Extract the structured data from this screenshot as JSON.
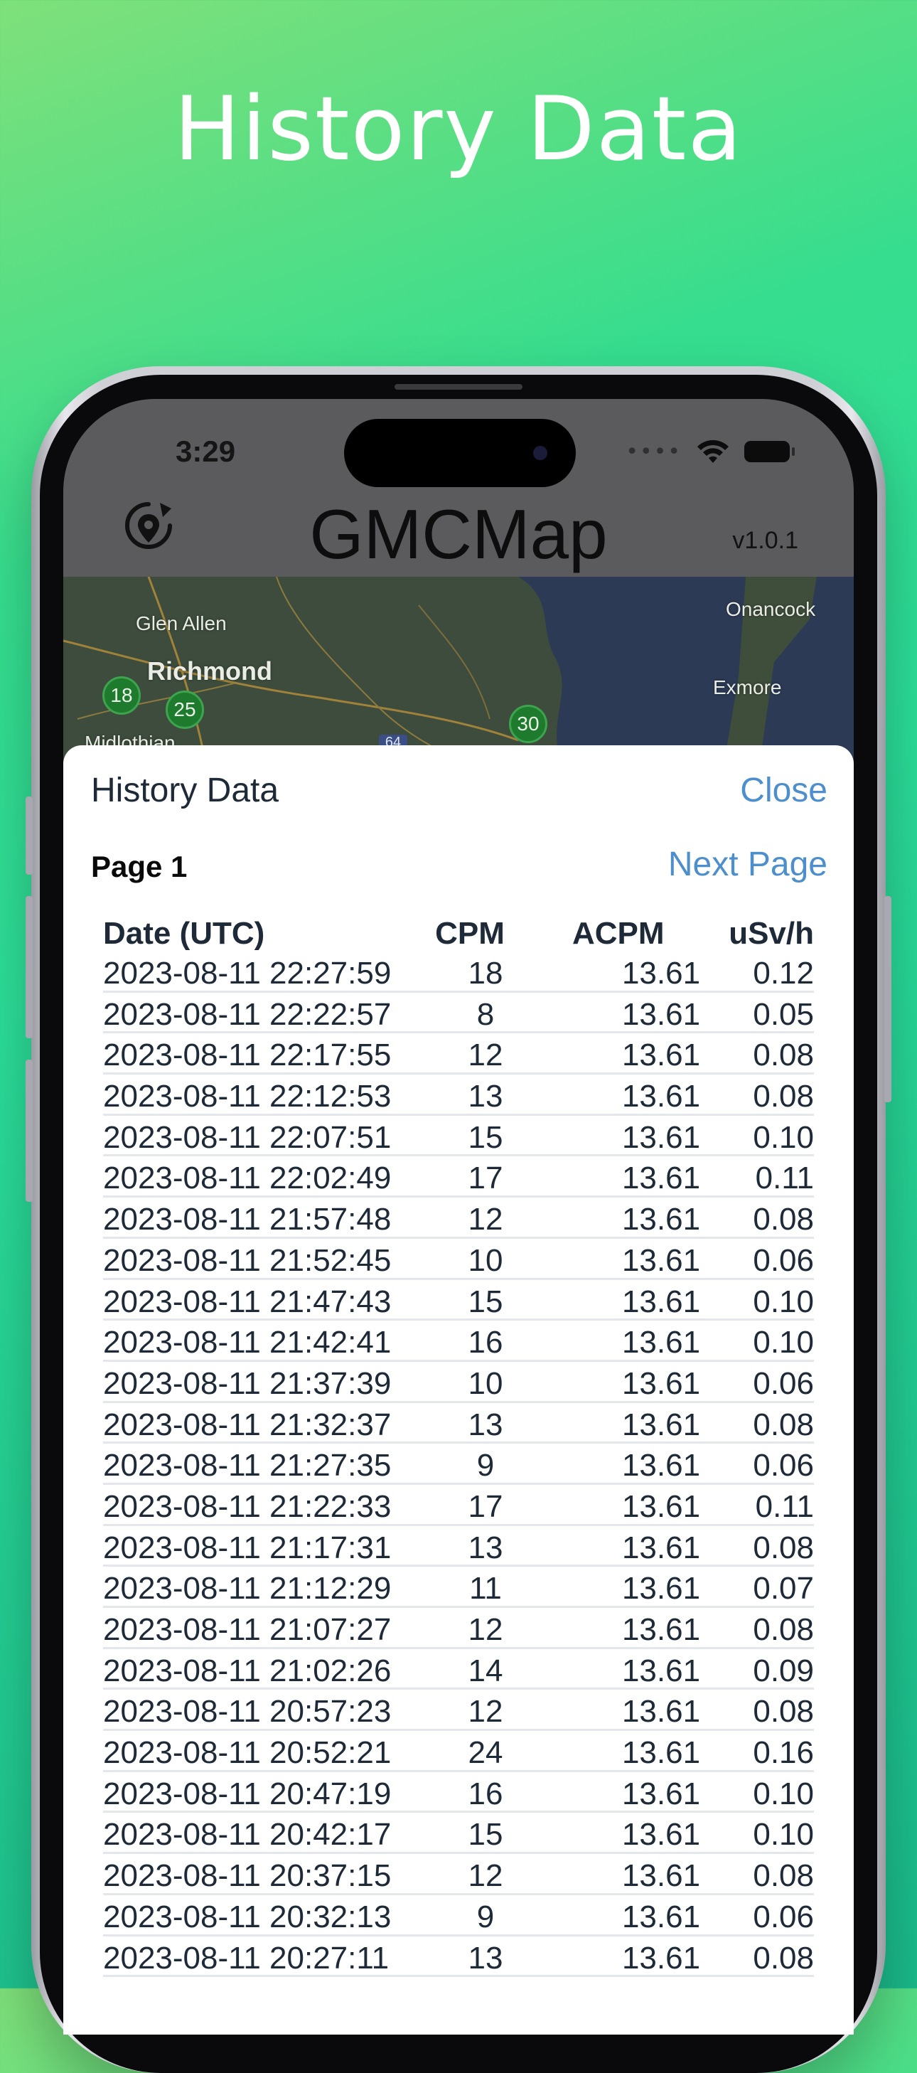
{
  "headline": "History Data",
  "status_bar": {
    "time": "3:29"
  },
  "app": {
    "title": "GMCMap",
    "version": "v1.0.1"
  },
  "map": {
    "labels": [
      "Glen Allen",
      "Richmond",
      "Midlothian",
      "Onancock",
      "Exmore"
    ],
    "markers": [
      "18",
      "25",
      "30"
    ],
    "shield": "64"
  },
  "sheet": {
    "title": "History Data",
    "close_label": "Close",
    "page_label": "Page 1",
    "next_page_label": "Next Page",
    "columns": [
      "Date (UTC)",
      "CPM",
      "ACPM",
      "uSv/h"
    ],
    "rows": [
      [
        "2023-08-11 22:27:59",
        "18",
        "13.61",
        "0.12"
      ],
      [
        "2023-08-11 22:22:57",
        "8",
        "13.61",
        "0.05"
      ],
      [
        "2023-08-11 22:17:55",
        "12",
        "13.61",
        "0.08"
      ],
      [
        "2023-08-11 22:12:53",
        "13",
        "13.61",
        "0.08"
      ],
      [
        "2023-08-11 22:07:51",
        "15",
        "13.61",
        "0.10"
      ],
      [
        "2023-08-11 22:02:49",
        "17",
        "13.61",
        "0.11"
      ],
      [
        "2023-08-11 21:57:48",
        "12",
        "13.61",
        "0.08"
      ],
      [
        "2023-08-11 21:52:45",
        "10",
        "13.61",
        "0.06"
      ],
      [
        "2023-08-11 21:47:43",
        "15",
        "13.61",
        "0.10"
      ],
      [
        "2023-08-11 21:42:41",
        "16",
        "13.61",
        "0.10"
      ],
      [
        "2023-08-11 21:37:39",
        "10",
        "13.61",
        "0.06"
      ],
      [
        "2023-08-11 21:32:37",
        "13",
        "13.61",
        "0.08"
      ],
      [
        "2023-08-11 21:27:35",
        "9",
        "13.61",
        "0.06"
      ],
      [
        "2023-08-11 21:22:33",
        "17",
        "13.61",
        "0.11"
      ],
      [
        "2023-08-11 21:17:31",
        "13",
        "13.61",
        "0.08"
      ],
      [
        "2023-08-11 21:12:29",
        "11",
        "13.61",
        "0.07"
      ],
      [
        "2023-08-11 21:07:27",
        "12",
        "13.61",
        "0.08"
      ],
      [
        "2023-08-11 21:02:26",
        "14",
        "13.61",
        "0.09"
      ],
      [
        "2023-08-11 20:57:23",
        "12",
        "13.61",
        "0.08"
      ],
      [
        "2023-08-11 20:52:21",
        "24",
        "13.61",
        "0.16"
      ],
      [
        "2023-08-11 20:47:19",
        "16",
        "13.61",
        "0.10"
      ],
      [
        "2023-08-11 20:42:17",
        "15",
        "13.61",
        "0.10"
      ],
      [
        "2023-08-11 20:37:15",
        "12",
        "13.61",
        "0.08"
      ],
      [
        "2023-08-11 20:32:13",
        "9",
        "13.61",
        "0.06"
      ],
      [
        "2023-08-11 20:27:11",
        "13",
        "13.61",
        "0.08"
      ]
    ]
  },
  "colors": {
    "link": "#4d8fcd",
    "text": "#1e2a38",
    "background_gradient": [
      "#7fe07a",
      "#2bdc98",
      "#1ab98a"
    ]
  },
  "icons": {
    "refresh": "location-refresh-icon",
    "wifi": "wifi-icon",
    "battery": "battery-icon",
    "signal": "signal-dots-icon"
  }
}
